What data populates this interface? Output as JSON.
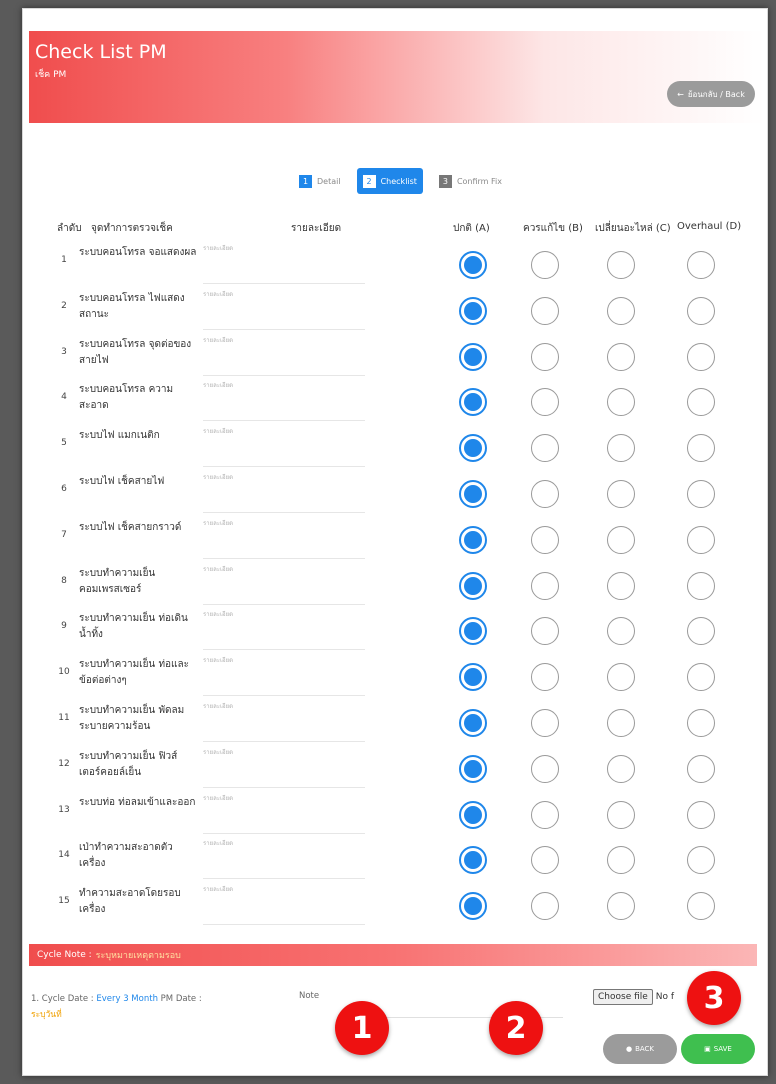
{
  "header": {
    "title": "Check List PM",
    "subtitle": "เช็ค PM",
    "back_label": "ย้อนกลับ / Back"
  },
  "steps": [
    {
      "num": "1",
      "label": "Detail"
    },
    {
      "num": "2",
      "label": "Checklist"
    },
    {
      "num": "3",
      "label": "Confirm Fix"
    }
  ],
  "table": {
    "headers": {
      "no": "ลำดับ",
      "point": "จุดทำการตรวจเช็ค",
      "detail": "รายละเอียด",
      "a": "ปกติ (A)",
      "b": "ควรแก้ไข (B)",
      "c": "เปลี่ยนอะไหล่ (C)",
      "d": "Overhaul (D)"
    },
    "detail_placeholder": "รายละเอียด",
    "rows": [
      {
        "no": "1",
        "item": "ระบบคอนโทรล จอแสดงผล",
        "selected": "A"
      },
      {
        "no": "2",
        "item": "ระบบคอนโทรล ไฟแสดงสถานะ",
        "selected": "A"
      },
      {
        "no": "3",
        "item": "ระบบคอนโทรล จุดต่อของสายไฟ",
        "selected": "A"
      },
      {
        "no": "4",
        "item": "ระบบคอนโทรล ความสะอาด",
        "selected": "A"
      },
      {
        "no": "5",
        "item": "ระบบไฟ แมกเนติก",
        "selected": "A"
      },
      {
        "no": "6",
        "item": "ระบบไฟ เช็คสายไฟ",
        "selected": "A"
      },
      {
        "no": "7",
        "item": "ระบบไฟ เช็คสายกราวด์",
        "selected": "A"
      },
      {
        "no": "8",
        "item": "ระบบทำความเย็น คอมเพรสเซอร์",
        "selected": "A"
      },
      {
        "no": "9",
        "item": "ระบบทำความเย็น ท่อเดินน้ำทิ้ง",
        "selected": "A"
      },
      {
        "no": "10",
        "item": "ระบบทำความเย็น ท่อและข้อต่อต่างๆ",
        "selected": "A"
      },
      {
        "no": "11",
        "item": "ระบบทำความเย็น พัดลมระบายความร้อน",
        "selected": "A"
      },
      {
        "no": "12",
        "item": "ระบบทำความเย็น ฟิวส์เตอร์คอยล์เย็น",
        "selected": "A"
      },
      {
        "no": "13",
        "item": "ระบบท่อ ท่อลมเข้าและออก",
        "selected": "A"
      },
      {
        "no": "14",
        "item": "เป่าทำความสะอาดตัวเครื่อง",
        "selected": "A"
      },
      {
        "no": "15",
        "item": "ทำความสะอาดโดยรอบเครื่อง",
        "selected": "A"
      }
    ]
  },
  "cycle_note": {
    "label": "Cycle Note :",
    "hint": "ระบุหมายเหตุตามรอบ"
  },
  "footer": {
    "cycle_prefix": "1. Cycle Date :",
    "cycle_value": "Every 3 Month",
    "pm_date_label": "PM Date :",
    "pm_date_value": "ระบุวันที่",
    "note_label": "Note",
    "choose_file": "Choose file",
    "no_file": "No f"
  },
  "buttons": {
    "back": "BACK",
    "save": "SAVE"
  },
  "markers": [
    "1",
    "2",
    "3"
  ],
  "colors": {
    "accent": "#1f87ea",
    "header_red": "#f04d4d",
    "save_green": "#3fbf4f",
    "marker_red": "#ee1111"
  }
}
